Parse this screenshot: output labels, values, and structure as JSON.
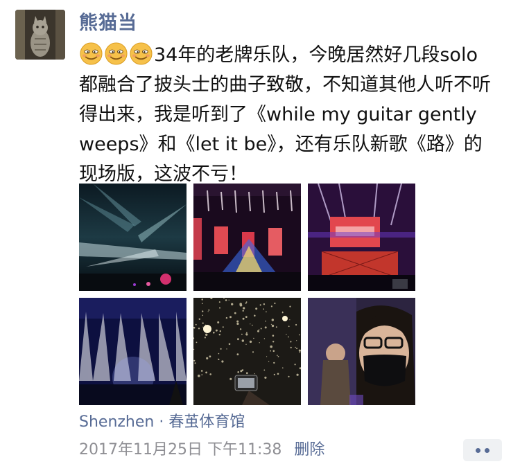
{
  "post": {
    "username": "熊猫当",
    "text": "34年的老牌乐队，今晚居然好几段solo都融合了披头士的曲子致敬，不知道其他人听不听得出来，我是听到了《while my guitar gently weeps》和《let it be》，还有乐队新歌《路》的现场版，这波不亏！",
    "emoji_count": 3,
    "emoji_icon": "grinning-face-icon",
    "photos": [
      {
        "icon": "concert-lights-photo"
      },
      {
        "icon": "concert-stage-photo"
      },
      {
        "icon": "concert-screen-photo"
      },
      {
        "icon": "concert-beams-photo"
      },
      {
        "icon": "concert-confetti-photo"
      },
      {
        "icon": "selfie-mask-photo"
      }
    ],
    "location": "Shenzhen · 春茧体育馆",
    "timestamp": "2017年11月25日 下午11:38",
    "delete_label": "删除",
    "more_icon": "more-dots-icon"
  },
  "colors": {
    "link": "#576b95",
    "text": "#111111",
    "meta": "#8e8e93",
    "more_bg": "#eff1f3"
  }
}
